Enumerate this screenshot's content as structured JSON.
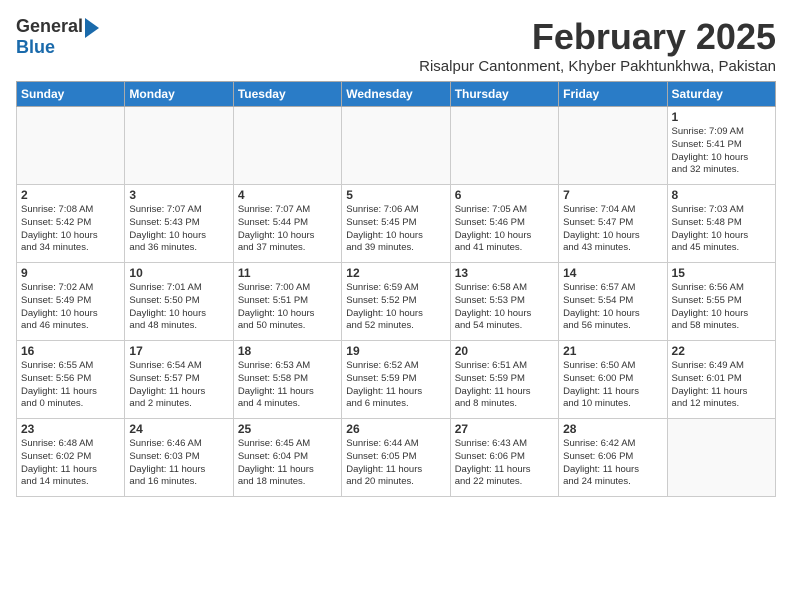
{
  "logo": {
    "line1": "General",
    "line2": "Blue"
  },
  "title": "February 2025",
  "subtitle": "Risalpur Cantonment, Khyber Pakhtunkhwa, Pakistan",
  "days_header": [
    "Sunday",
    "Monday",
    "Tuesday",
    "Wednesday",
    "Thursday",
    "Friday",
    "Saturday"
  ],
  "weeks": [
    [
      {
        "day": "",
        "info": ""
      },
      {
        "day": "",
        "info": ""
      },
      {
        "day": "",
        "info": ""
      },
      {
        "day": "",
        "info": ""
      },
      {
        "day": "",
        "info": ""
      },
      {
        "day": "",
        "info": ""
      },
      {
        "day": "1",
        "info": "Sunrise: 7:09 AM\nSunset: 5:41 PM\nDaylight: 10 hours\nand 32 minutes."
      }
    ],
    [
      {
        "day": "2",
        "info": "Sunrise: 7:08 AM\nSunset: 5:42 PM\nDaylight: 10 hours\nand 34 minutes."
      },
      {
        "day": "3",
        "info": "Sunrise: 7:07 AM\nSunset: 5:43 PM\nDaylight: 10 hours\nand 36 minutes."
      },
      {
        "day": "4",
        "info": "Sunrise: 7:07 AM\nSunset: 5:44 PM\nDaylight: 10 hours\nand 37 minutes."
      },
      {
        "day": "5",
        "info": "Sunrise: 7:06 AM\nSunset: 5:45 PM\nDaylight: 10 hours\nand 39 minutes."
      },
      {
        "day": "6",
        "info": "Sunrise: 7:05 AM\nSunset: 5:46 PM\nDaylight: 10 hours\nand 41 minutes."
      },
      {
        "day": "7",
        "info": "Sunrise: 7:04 AM\nSunset: 5:47 PM\nDaylight: 10 hours\nand 43 minutes."
      },
      {
        "day": "8",
        "info": "Sunrise: 7:03 AM\nSunset: 5:48 PM\nDaylight: 10 hours\nand 45 minutes."
      }
    ],
    [
      {
        "day": "9",
        "info": "Sunrise: 7:02 AM\nSunset: 5:49 PM\nDaylight: 10 hours\nand 46 minutes."
      },
      {
        "day": "10",
        "info": "Sunrise: 7:01 AM\nSunset: 5:50 PM\nDaylight: 10 hours\nand 48 minutes."
      },
      {
        "day": "11",
        "info": "Sunrise: 7:00 AM\nSunset: 5:51 PM\nDaylight: 10 hours\nand 50 minutes."
      },
      {
        "day": "12",
        "info": "Sunrise: 6:59 AM\nSunset: 5:52 PM\nDaylight: 10 hours\nand 52 minutes."
      },
      {
        "day": "13",
        "info": "Sunrise: 6:58 AM\nSunset: 5:53 PM\nDaylight: 10 hours\nand 54 minutes."
      },
      {
        "day": "14",
        "info": "Sunrise: 6:57 AM\nSunset: 5:54 PM\nDaylight: 10 hours\nand 56 minutes."
      },
      {
        "day": "15",
        "info": "Sunrise: 6:56 AM\nSunset: 5:55 PM\nDaylight: 10 hours\nand 58 minutes."
      }
    ],
    [
      {
        "day": "16",
        "info": "Sunrise: 6:55 AM\nSunset: 5:56 PM\nDaylight: 11 hours\nand 0 minutes."
      },
      {
        "day": "17",
        "info": "Sunrise: 6:54 AM\nSunset: 5:57 PM\nDaylight: 11 hours\nand 2 minutes."
      },
      {
        "day": "18",
        "info": "Sunrise: 6:53 AM\nSunset: 5:58 PM\nDaylight: 11 hours\nand 4 minutes."
      },
      {
        "day": "19",
        "info": "Sunrise: 6:52 AM\nSunset: 5:59 PM\nDaylight: 11 hours\nand 6 minutes."
      },
      {
        "day": "20",
        "info": "Sunrise: 6:51 AM\nSunset: 5:59 PM\nDaylight: 11 hours\nand 8 minutes."
      },
      {
        "day": "21",
        "info": "Sunrise: 6:50 AM\nSunset: 6:00 PM\nDaylight: 11 hours\nand 10 minutes."
      },
      {
        "day": "22",
        "info": "Sunrise: 6:49 AM\nSunset: 6:01 PM\nDaylight: 11 hours\nand 12 minutes."
      }
    ],
    [
      {
        "day": "23",
        "info": "Sunrise: 6:48 AM\nSunset: 6:02 PM\nDaylight: 11 hours\nand 14 minutes."
      },
      {
        "day": "24",
        "info": "Sunrise: 6:46 AM\nSunset: 6:03 PM\nDaylight: 11 hours\nand 16 minutes."
      },
      {
        "day": "25",
        "info": "Sunrise: 6:45 AM\nSunset: 6:04 PM\nDaylight: 11 hours\nand 18 minutes."
      },
      {
        "day": "26",
        "info": "Sunrise: 6:44 AM\nSunset: 6:05 PM\nDaylight: 11 hours\nand 20 minutes."
      },
      {
        "day": "27",
        "info": "Sunrise: 6:43 AM\nSunset: 6:06 PM\nDaylight: 11 hours\nand 22 minutes."
      },
      {
        "day": "28",
        "info": "Sunrise: 6:42 AM\nSunset: 6:06 PM\nDaylight: 11 hours\nand 24 minutes."
      },
      {
        "day": "",
        "info": ""
      }
    ]
  ]
}
